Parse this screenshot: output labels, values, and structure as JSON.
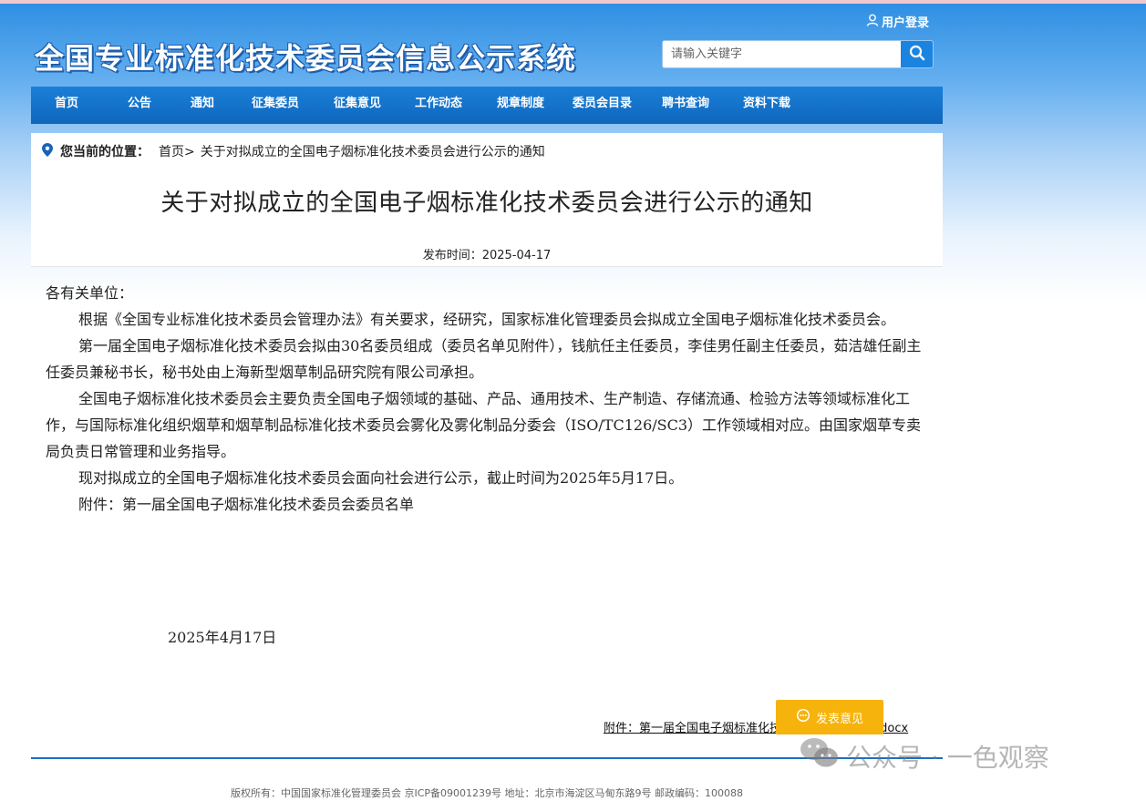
{
  "header": {
    "login_label": "用户登录",
    "site_title": "全国专业标准化技术委员会信息公示系统",
    "search_placeholder": "请输入关键字"
  },
  "nav": {
    "items": [
      "首页",
      "公告",
      "通知",
      "征集委员",
      "征集意见",
      "工作动态",
      "规章制度",
      "委员会目录",
      "聘书查询",
      "资料下载"
    ]
  },
  "breadcrumb": {
    "label": "您当前的位置：",
    "home": "首页>",
    "current": "关于对拟成立的全国电子烟标准化技术委员会进行公示的通知"
  },
  "article": {
    "title": "关于对拟成立的全国电子烟标准化技术委员会进行公示的通知",
    "publish_date": "发布时间：2025-04-17",
    "salutation": "各有关单位：",
    "paragraphs": [
      "根据《全国专业标准化技术委员会管理办法》有关要求，经研究，国家标准化管理委员会拟成立全国电子烟标准化技术委员会。",
      "第一届全国电子烟标准化技术委员会拟由30名委员组成（委员名单见附件），钱航任主任委员，李佳男任副主任委员，茹洁雄任副主任委员兼秘书长，秘书处由上海新型烟草制品研究院有限公司承担。",
      "全国电子烟标准化技术委员会主要负责全国电子烟领域的基础、产品、通用技术、生产制造、存储流通、检验方法等领域标准化工作，与国际标准化组织烟草和烟草制品标准化技术委员会雾化及雾化制品分委会（ISO/TC126/SC3）工作领域相对应。由国家烟草专卖局负责日常管理和业务指导。",
      "现对拟成立的全国电子烟标准化技术委员会面向社会进行公示，截止时间为2025年5月17日。",
      "附件：第一届全国电子烟标准化技术委员会委员名单"
    ],
    "sign_date": "2025年4月17日",
    "attachment_link": "附件：第一届全国电子烟标准化技术委员会委员名单.docx"
  },
  "feedback_button": "发表意见",
  "footer": {
    "copyright": "版权所有：中国国家标准化管理委员会 京ICP备09001239号 地址：北京市海淀区马甸东路9号 邮政编码：100088"
  },
  "watermark": "公众号 · 一色观察",
  "colors": {
    "nav_bg": "#0f67bd",
    "header_blue": "#2f8fe3",
    "feedback_orange": "#f6b30c",
    "footer_line": "#1d6ec2"
  }
}
